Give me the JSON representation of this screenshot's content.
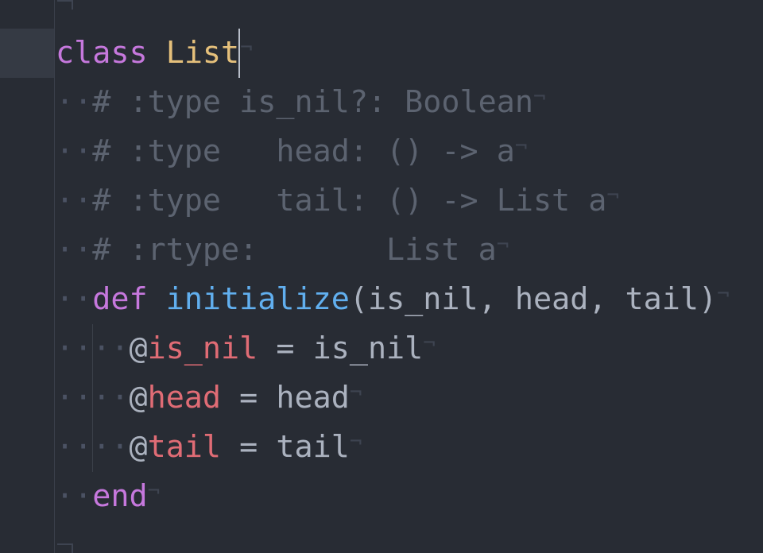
{
  "editor": {
    "lines": [
      {
        "tokens": [
          {
            "t": "class",
            "c": "kw"
          },
          {
            "t": " ",
            "c": ""
          },
          {
            "t": "List",
            "c": "cls"
          }
        ],
        "cursor": true
      },
      {
        "tokens": [
          {
            "t": "··",
            "c": "ws"
          },
          {
            "t": "# :type is_nil?: Boolean",
            "c": "cmt"
          }
        ]
      },
      {
        "tokens": [
          {
            "t": "··",
            "c": "ws"
          },
          {
            "t": "# :type   head: () -> a",
            "c": "cmt"
          }
        ]
      },
      {
        "tokens": [
          {
            "t": "··",
            "c": "ws"
          },
          {
            "t": "# :type   tail: () -> List a",
            "c": "cmt"
          }
        ]
      },
      {
        "tokens": [
          {
            "t": "··",
            "c": "ws"
          },
          {
            "t": "# :rtype:       List a",
            "c": "cmt"
          }
        ]
      },
      {
        "tokens": [
          {
            "t": "··",
            "c": "ws"
          },
          {
            "t": "def",
            "c": "kw"
          },
          {
            "t": " ",
            "c": ""
          },
          {
            "t": "initialize",
            "c": "fn"
          },
          {
            "t": "(is_nil, head, tail)",
            "c": ""
          }
        ]
      },
      {
        "tokens": [
          {
            "t": "····",
            "c": "ws"
          },
          {
            "t": "@",
            "c": ""
          },
          {
            "t": "is_nil",
            "c": "ivar"
          },
          {
            "t": " = is_nil",
            "c": ""
          }
        ]
      },
      {
        "tokens": [
          {
            "t": "····",
            "c": "ws"
          },
          {
            "t": "@",
            "c": ""
          },
          {
            "t": "head",
            "c": "ivar"
          },
          {
            "t": " = head",
            "c": ""
          }
        ]
      },
      {
        "tokens": [
          {
            "t": "····",
            "c": "ws"
          },
          {
            "t": "@",
            "c": ""
          },
          {
            "t": "tail",
            "c": "ivar"
          },
          {
            "t": " = tail",
            "c": ""
          }
        ]
      },
      {
        "tokens": [
          {
            "t": "··",
            "c": "ws"
          },
          {
            "t": "end",
            "c": "kw"
          }
        ]
      }
    ],
    "eol_marker": "¬"
  }
}
